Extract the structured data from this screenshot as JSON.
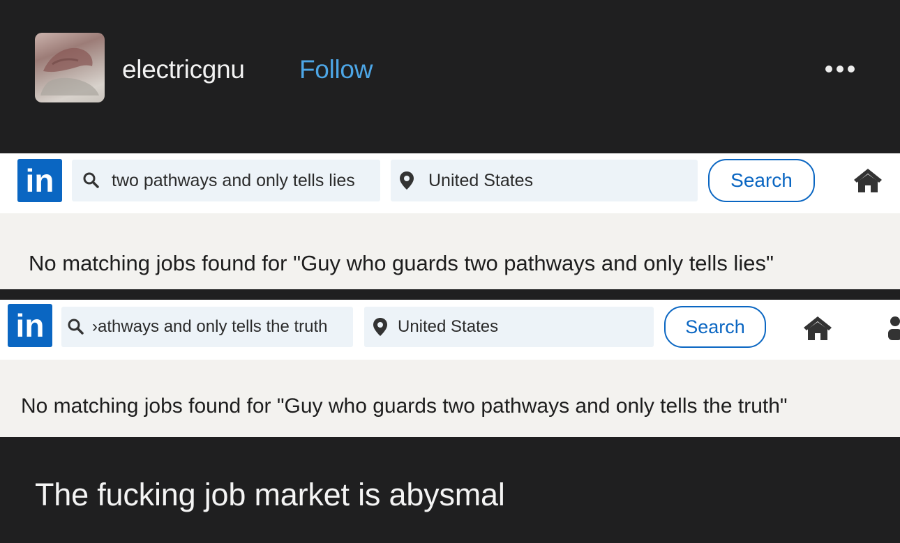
{
  "post": {
    "username": "electricgnu",
    "follow_label": "Follow",
    "more_icon": "ellipsis-icon",
    "caption": "The fucking job market is abysmal"
  },
  "screenshots": [
    {
      "logo": "in",
      "search_value": "two pathways and only tells lies",
      "location_value": "United States",
      "search_button": "Search",
      "message": "No matching jobs found for \"Guy who guards two pathways and only tells lies\""
    },
    {
      "logo": "in",
      "search_value": "›athways and only tells the truth",
      "location_value": "United States",
      "search_button": "Search",
      "message": "No matching jobs found for \"Guy who guards two pathways and only tells the truth\""
    }
  ],
  "colors": {
    "background": "#1f1f20",
    "follow": "#4da6e6",
    "linkedin_blue": "#0a66c2",
    "result_bg": "#f3f2ef"
  }
}
